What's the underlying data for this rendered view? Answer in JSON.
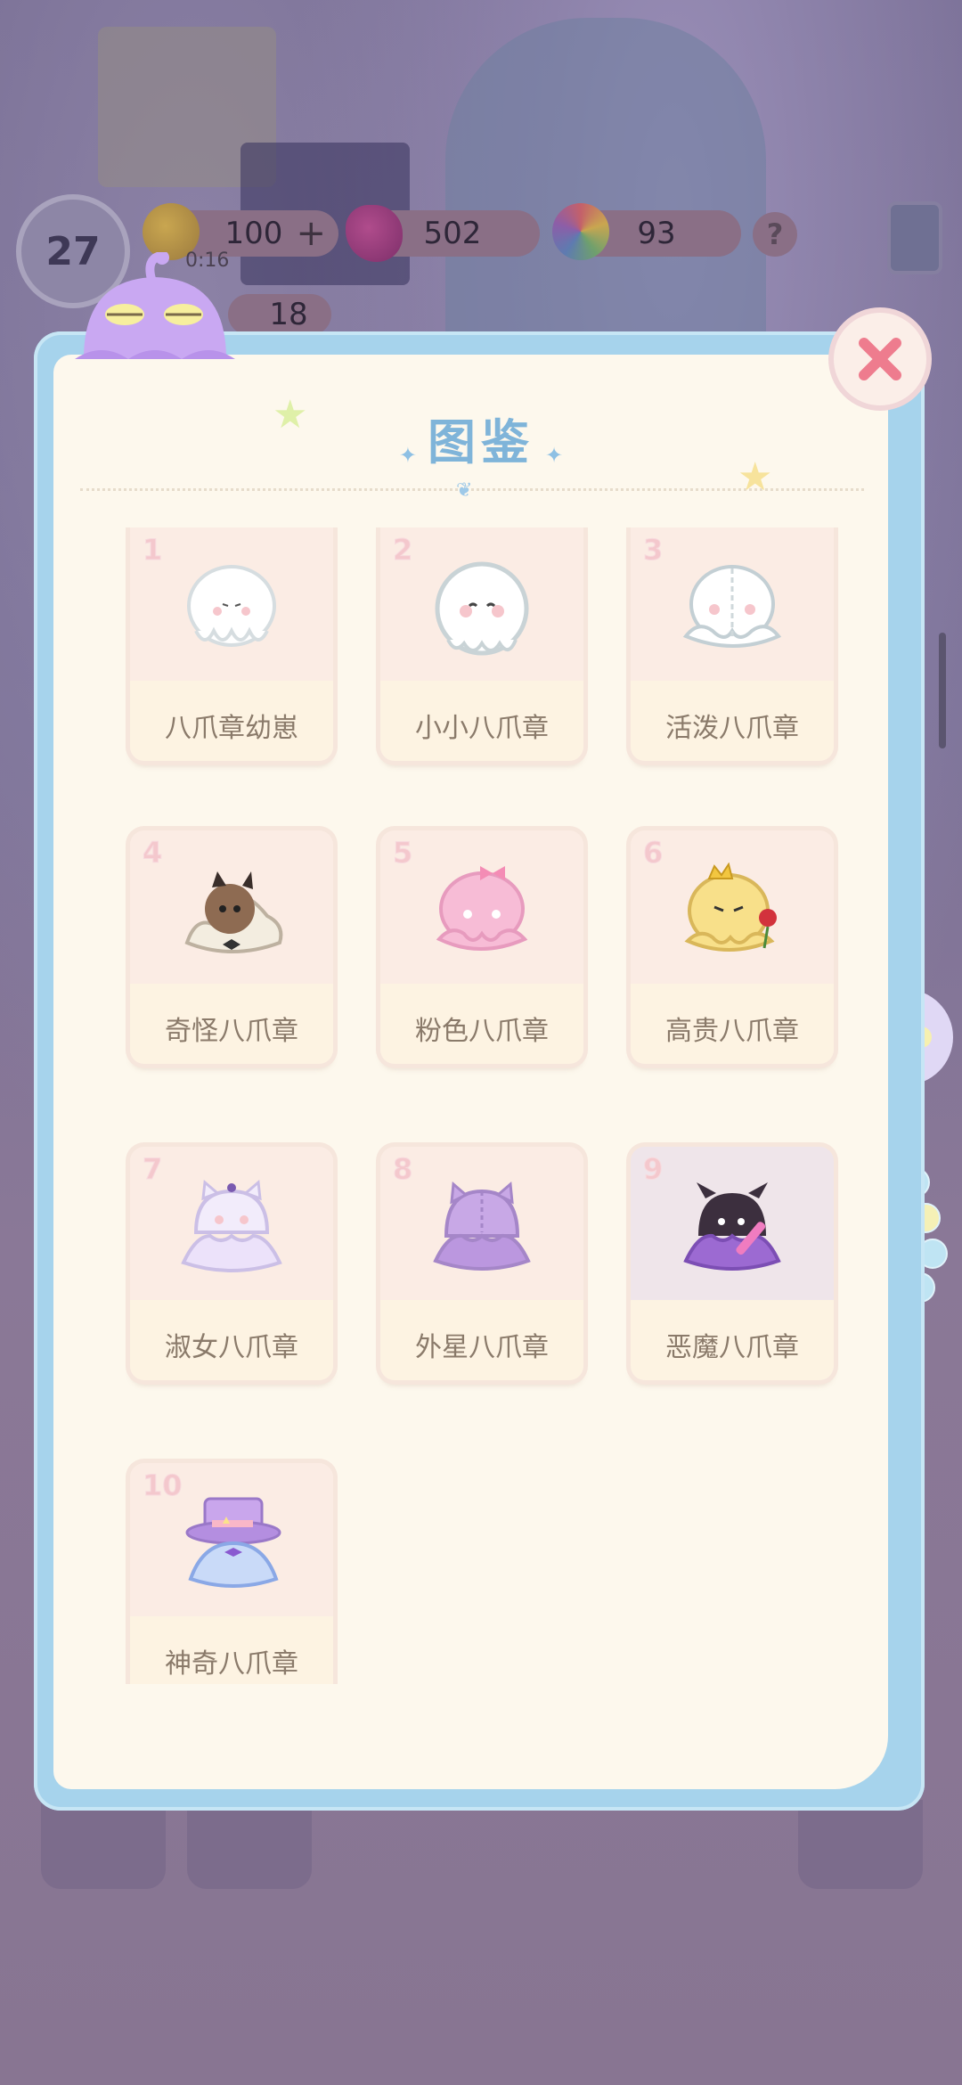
{
  "hud": {
    "level": "27",
    "energy": "100",
    "energy_plus": "+",
    "energy_timer": "0:16",
    "gems": "502",
    "rainbow": "93",
    "help": "?",
    "tickets": "18"
  },
  "panel": {
    "title": "图鉴",
    "close_label": "✕"
  },
  "collection": [
    {
      "num": "1",
      "name": "八爪章幼崽"
    },
    {
      "num": "2",
      "name": "小小八爪章"
    },
    {
      "num": "3",
      "name": "活泼八爪章"
    },
    {
      "num": "4",
      "name": "奇怪八爪章"
    },
    {
      "num": "5",
      "name": "粉色八爪章"
    },
    {
      "num": "6",
      "name": "高贵八爪章"
    },
    {
      "num": "7",
      "name": "淑女八爪章"
    },
    {
      "num": "8",
      "name": "外星八爪章"
    },
    {
      "num": "9",
      "name": "恶魔八爪章"
    },
    {
      "num": "10",
      "name": "神奇八爪章"
    }
  ],
  "colors": {
    "panel_border": "#a6d3ec",
    "panel_bg": "#fdf8ed",
    "title": "#7fb4d9",
    "card_num": "#f4c8cd"
  }
}
